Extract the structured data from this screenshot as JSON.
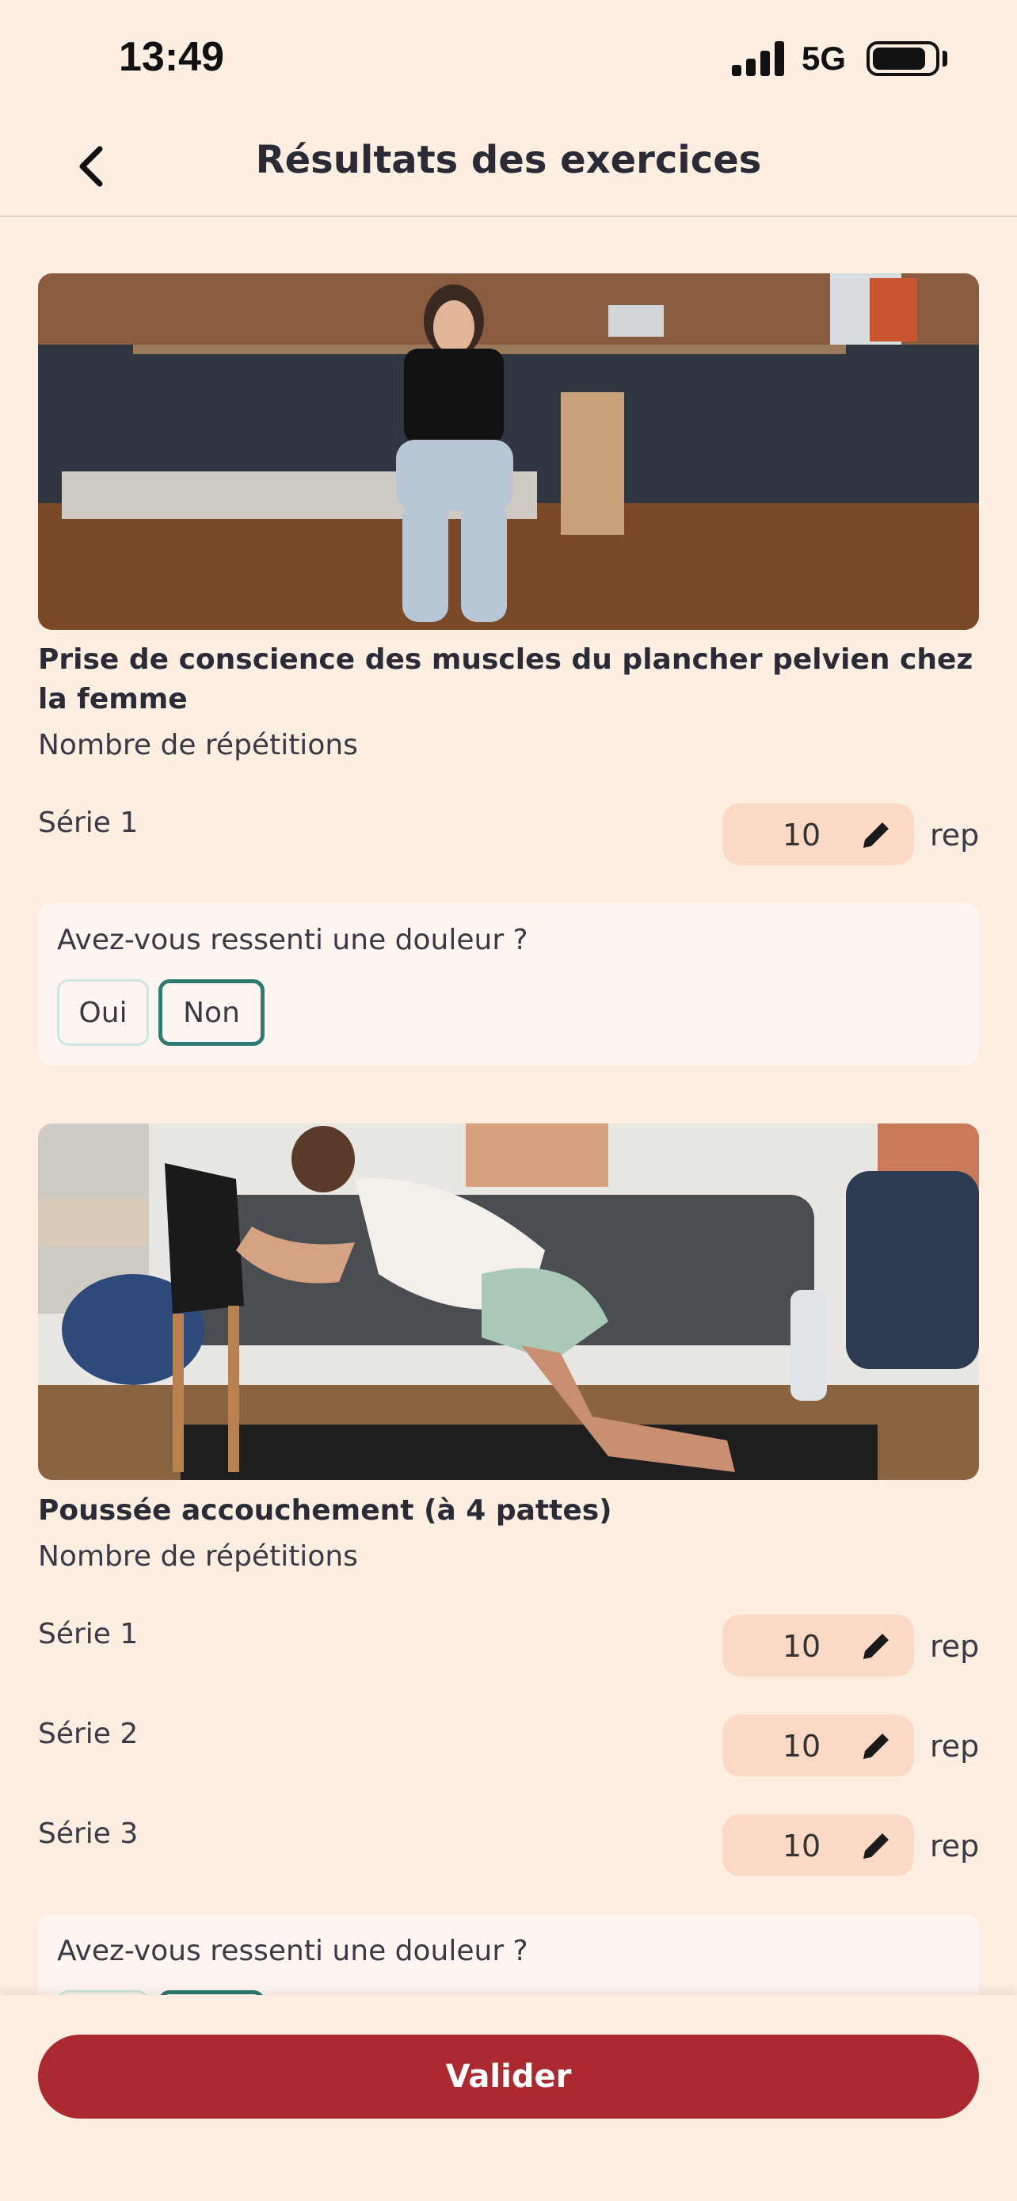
{
  "status_bar": {
    "time": "13:49",
    "network": "5G"
  },
  "header": {
    "title": "Résultats des exercices"
  },
  "exercises": [
    {
      "title": "Prise de conscience des muscles du plancher pelvien chez la femme",
      "reps_label": "Nombre de répétitions",
      "series": [
        {
          "label": "Série 1",
          "value": "10",
          "unit": "rep"
        }
      ],
      "pain_question": "Avez-vous ressenti une douleur ?",
      "options": [
        "Oui",
        "Non"
      ],
      "selected": "Non"
    },
    {
      "title": "Poussée accouchement (à 4 pattes)",
      "reps_label": "Nombre de répétitions",
      "series": [
        {
          "label": "Série 1",
          "value": "10",
          "unit": "rep"
        },
        {
          "label": "Série 2",
          "value": "10",
          "unit": "rep"
        },
        {
          "label": "Série 3",
          "value": "10",
          "unit": "rep"
        }
      ],
      "pain_question": "Avez-vous ressenti une douleur ?"
    }
  ],
  "footer": {
    "validate_label": "Valider"
  },
  "colors": {
    "background": "#fdeee2",
    "accent": "#ab2a30",
    "teal": "#2f7b71",
    "input_bg": "#fcd9c4"
  }
}
